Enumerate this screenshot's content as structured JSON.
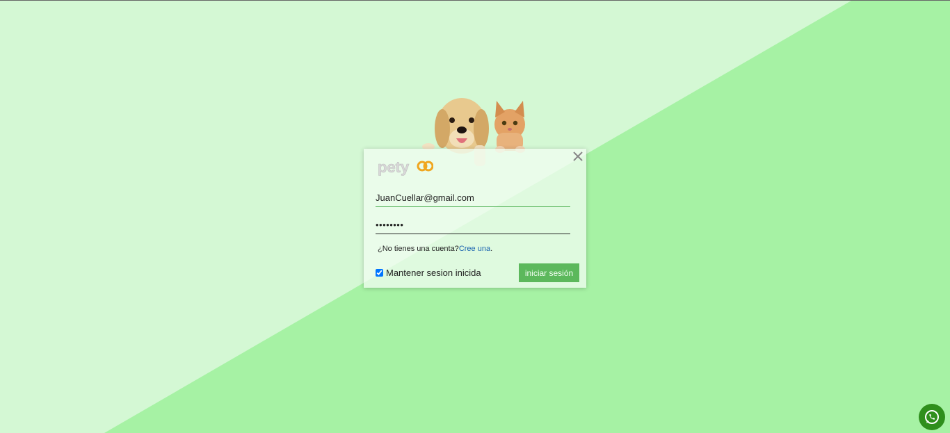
{
  "login": {
    "logo_text": "pety",
    "email_value": "JuanCuellar@gmail.com",
    "password_value": "••••••••",
    "signup_prompt": "¿No tienes una cuenta?",
    "signup_link": "Cree una",
    "signup_suffix": ".",
    "remember_label": "Mantener sesion inicida",
    "remember_checked": true,
    "submit_label": "iniciar sesión"
  },
  "icons": {
    "close": "close-icon",
    "whatsapp": "whatsapp-icon"
  },
  "colors": {
    "bg_light": "#d4f8d4",
    "bg_dark": "#a4f2a4",
    "button": "#5cb85c",
    "link": "#1a63b0",
    "whatsapp": "#2f8f1c",
    "logo_accent": "#f0a61f"
  }
}
